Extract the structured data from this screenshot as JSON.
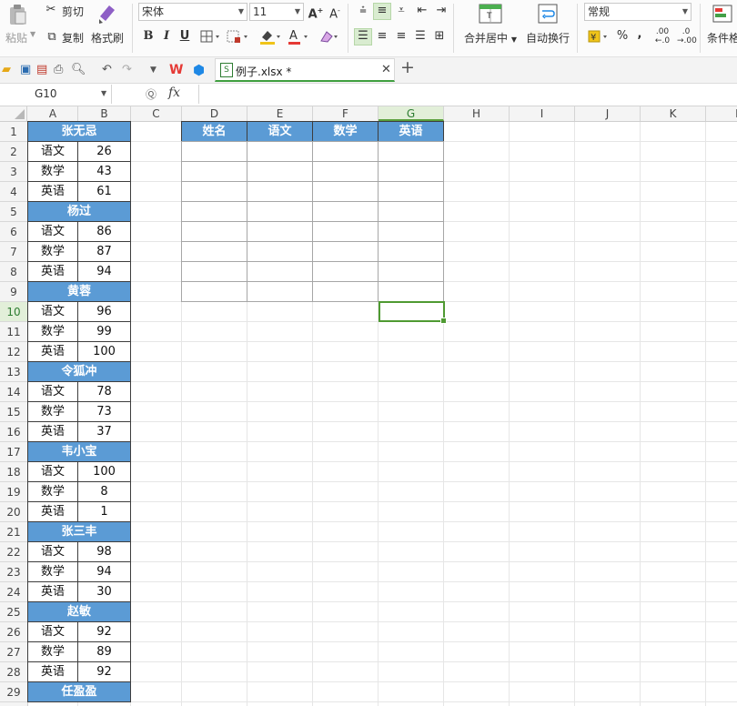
{
  "ribbon": {
    "paste": "粘贴",
    "cut": "剪切",
    "copy": "复制",
    "format_painter": "格式刷",
    "font_name": "宋体",
    "font_size": "11",
    "bold": "B",
    "italic": "I",
    "underline": "U",
    "merge_center": "合并居中",
    "wrap_text": "自动换行",
    "number_format": "常规",
    "percent": "%",
    "comma": ",",
    "dec_inc": ".00",
    "dec_dec": ".0",
    "conditional": "条件格"
  },
  "tabbar": {
    "file_name": "例子.xlsx *"
  },
  "formula_bar": {
    "name_box": "G10",
    "fx": "fx",
    "content": ""
  },
  "columns": [
    "A",
    "B",
    "C",
    "D",
    "E",
    "F",
    "G",
    "H",
    "I",
    "J",
    "K",
    "L"
  ],
  "active_column": "G",
  "active_row": 10,
  "rows": [
    "1",
    "2",
    "3",
    "4",
    "5",
    "6",
    "7",
    "8",
    "9",
    "10",
    "11",
    "12",
    "13",
    "14",
    "15",
    "16",
    "17",
    "18",
    "19",
    "20",
    "21",
    "22",
    "23",
    "24",
    "25",
    "26",
    "27",
    "28",
    "29"
  ],
  "students": [
    {
      "name": "张无忌",
      "scores": [
        {
          "subject": "语文",
          "value": "26"
        },
        {
          "subject": "数学",
          "value": "43"
        },
        {
          "subject": "英语",
          "value": "61"
        }
      ]
    },
    {
      "name": "杨过",
      "scores": [
        {
          "subject": "语文",
          "value": "86"
        },
        {
          "subject": "数学",
          "value": "87"
        },
        {
          "subject": "英语",
          "value": "94"
        }
      ]
    },
    {
      "name": "黄蓉",
      "scores": [
        {
          "subject": "语文",
          "value": "96"
        },
        {
          "subject": "数学",
          "value": "99"
        },
        {
          "subject": "英语",
          "value": "100"
        }
      ]
    },
    {
      "name": "令狐冲",
      "scores": [
        {
          "subject": "语文",
          "value": "78"
        },
        {
          "subject": "数学",
          "value": "73"
        },
        {
          "subject": "英语",
          "value": "37"
        }
      ]
    },
    {
      "name": "韦小宝",
      "scores": [
        {
          "subject": "语文",
          "value": "100"
        },
        {
          "subject": "数学",
          "value": "8"
        },
        {
          "subject": "英语",
          "value": "1"
        }
      ]
    },
    {
      "name": "张三丰",
      "scores": [
        {
          "subject": "语文",
          "value": "98"
        },
        {
          "subject": "数学",
          "value": "94"
        },
        {
          "subject": "英语",
          "value": "30"
        }
      ]
    },
    {
      "name": "赵敏",
      "scores": [
        {
          "subject": "语文",
          "value": "92"
        },
        {
          "subject": "数学",
          "value": "89"
        },
        {
          "subject": "英语",
          "value": "92"
        }
      ]
    },
    {
      "name": "任盈盈",
      "scores": []
    }
  ],
  "summary_headers": [
    "姓名",
    "语文",
    "数学",
    "英语"
  ],
  "colors": {
    "header_fill": "#5b9bd5",
    "selection": "#4f9a32",
    "active_header": "#e2efd9"
  }
}
